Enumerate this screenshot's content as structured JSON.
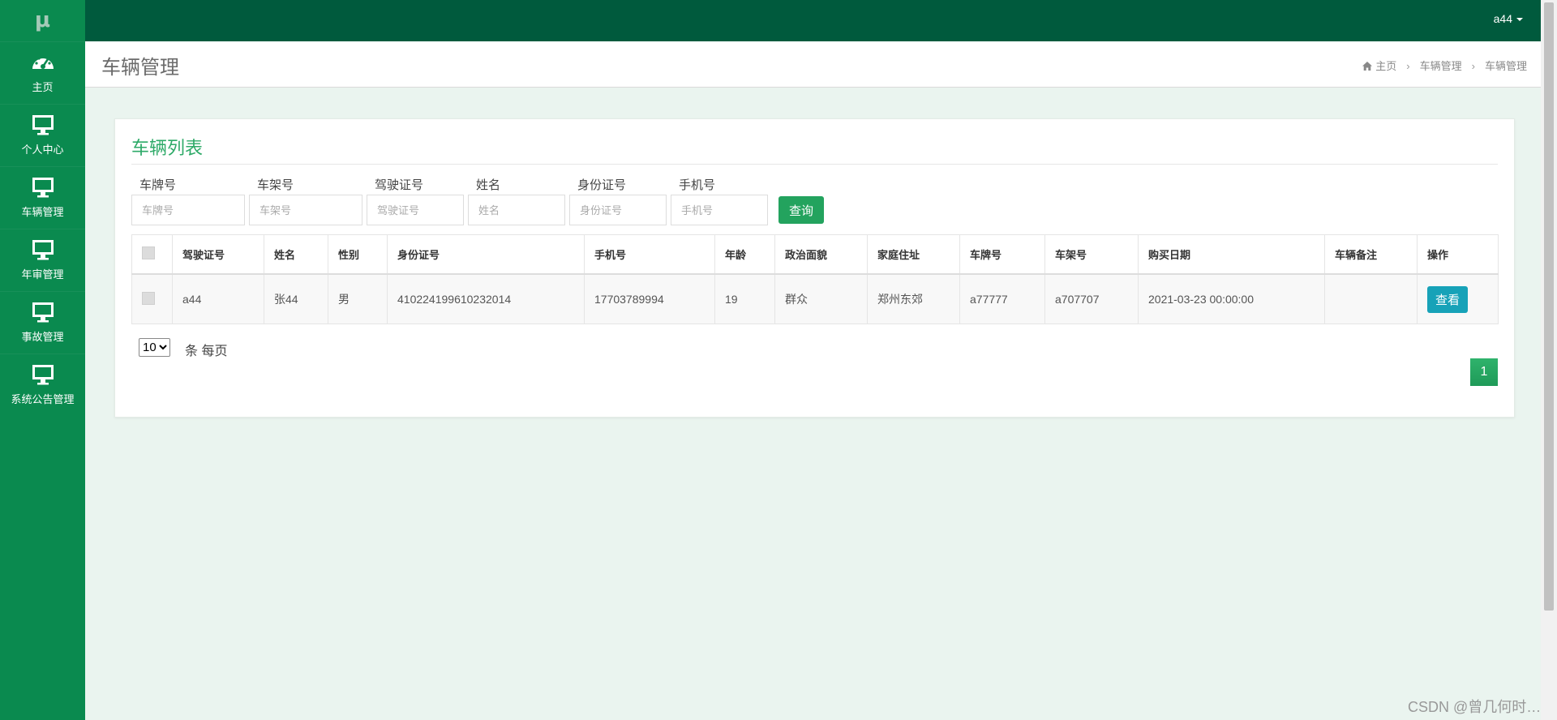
{
  "sidebar": {
    "logo": "μ",
    "items": [
      {
        "label": "主页",
        "icon": "dashboard-icon"
      },
      {
        "label": "个人中心",
        "icon": "monitor-icon"
      },
      {
        "label": "车辆管理",
        "icon": "monitor-icon"
      },
      {
        "label": "年审管理",
        "icon": "monitor-icon"
      },
      {
        "label": "事故管理",
        "icon": "monitor-icon"
      },
      {
        "label": "系统公告管理",
        "icon": "monitor-icon"
      }
    ]
  },
  "topbar": {
    "user": "a44"
  },
  "page": {
    "title": "车辆管理",
    "breadcrumb": [
      "主页",
      "车辆管理",
      "车辆管理"
    ]
  },
  "card": {
    "title": "车辆列表"
  },
  "search": {
    "fields": [
      {
        "label": "车牌号",
        "placeholder": "车牌号"
      },
      {
        "label": "车架号",
        "placeholder": "车架号"
      },
      {
        "label": "驾驶证号",
        "placeholder": "驾驶证号"
      },
      {
        "label": "姓名",
        "placeholder": "姓名"
      },
      {
        "label": "身份证号",
        "placeholder": "身份证号"
      },
      {
        "label": "手机号",
        "placeholder": "手机号"
      }
    ],
    "button": "查询"
  },
  "table": {
    "headers": [
      "驾驶证号",
      "姓名",
      "性别",
      "身份证号",
      "手机号",
      "年龄",
      "政治面貌",
      "家庭住址",
      "车牌号",
      "车架号",
      "购买日期",
      "车辆备注",
      "操作"
    ],
    "rows": [
      [
        "a44",
        "张44",
        "男",
        "410224199610232014",
        "17703789994",
        "19",
        "群众",
        "郑州东郊",
        "a77777",
        "a707707",
        "2021-03-23 00:00:00",
        ""
      ]
    ],
    "action_label": "查看"
  },
  "pagination": {
    "page_size": "10",
    "per_page_text": "条 每页",
    "current_page": "1"
  },
  "watermark": "CSDN @曾几何时…",
  "colors": {
    "sidebar": "#0a8a4f",
    "topbar": "#005a3d",
    "accent": "#23a35e",
    "view_button": "#17a2b8"
  }
}
